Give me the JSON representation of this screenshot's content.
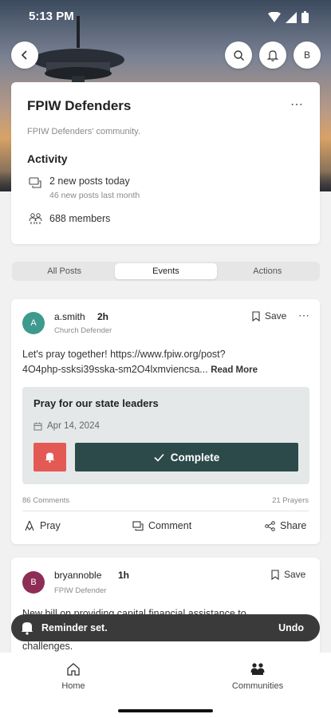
{
  "status_bar": {
    "time": "5:13 PM"
  },
  "header_actions": {
    "profile_initial": "B"
  },
  "community": {
    "name": "FPIW Defenders",
    "description": "FPIW Defenders' community.",
    "activity_heading": "Activity",
    "posts_today": "2 new posts today",
    "posts_last_month": "46 new posts last month",
    "members": "688 members"
  },
  "tabs": [
    {
      "label": "All Posts"
    },
    {
      "label": "Events"
    },
    {
      "label": "Actions"
    }
  ],
  "post1": {
    "avatar_initial": "A",
    "avatar_color": "#3d9a8c",
    "author": "a.smith",
    "time": "2h",
    "role": "Church Defender",
    "save_label": "Save",
    "text_line1": "Let's pray together! https://www.fpiw.org/post?",
    "text_line2": "4O4php-ssksi39sska-sm2O4lxmviencsa...",
    "read_more": "Read More",
    "event": {
      "title": "Pray for our state leaders",
      "date": "Apr 14, 2024",
      "complete_label": "Complete"
    },
    "comments_count": "86 Comments",
    "prayers_count": "21 Prayers",
    "pray_label": "Pray",
    "comment_label": "Comment",
    "share_label": "Share"
  },
  "post2": {
    "avatar_initial": "B",
    "avatar_color": "#8e2d55",
    "author": "bryannoble",
    "time": "1h",
    "role": "FPIW Defender",
    "save_label": "Save",
    "text_line1": "New bill on providing capital financial assistance to",
    "text_line2": "challenges."
  },
  "snackbar": {
    "message": "Reminder set.",
    "action": "Undo"
  },
  "bottom_nav": [
    {
      "label": "Home"
    },
    {
      "label": "Communities"
    }
  ],
  "colors": {
    "accent_dark": "#2d4a4b",
    "alert_red": "#e35a55"
  }
}
